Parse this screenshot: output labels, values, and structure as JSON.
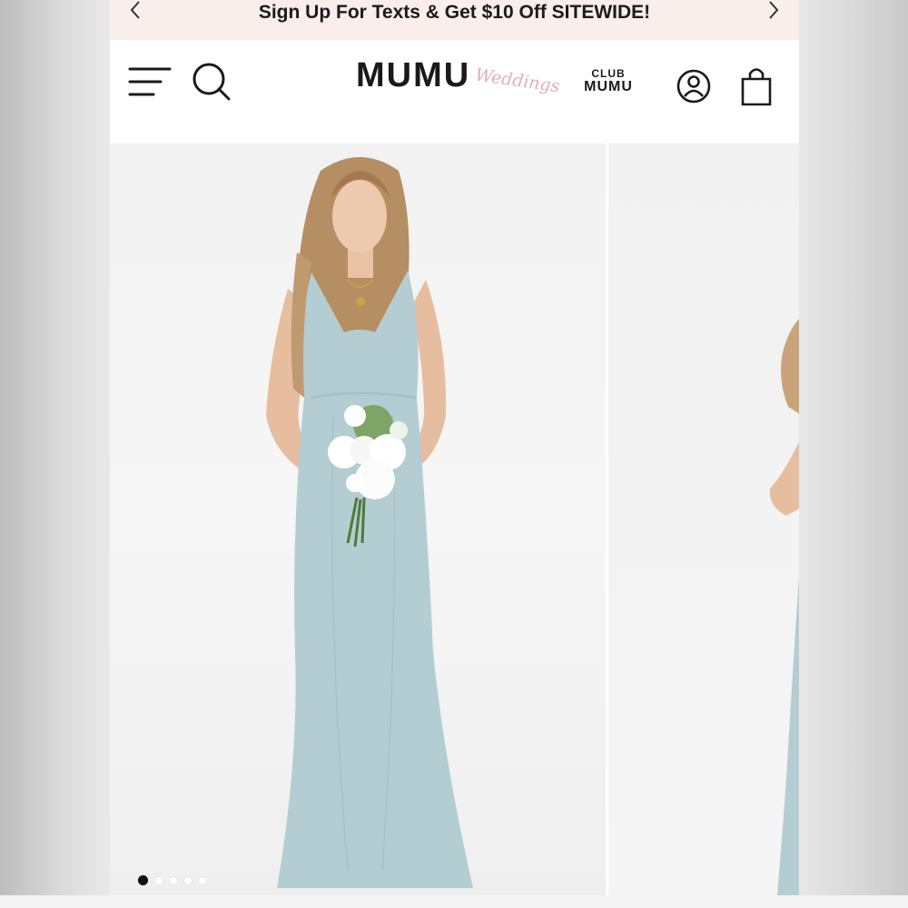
{
  "promo": {
    "text": "Sign Up For Texts & Get $10 Off SITEWIDE!"
  },
  "header": {
    "logo_text": "MUMU",
    "logo_script": "Weddings",
    "club_small": "CLUB",
    "club_big": "MUMU",
    "icons": [
      "menu-icon",
      "search-icon",
      "account-icon",
      "shopping-bag-icon"
    ]
  },
  "gallery": {
    "dots_total": 5,
    "active_dot": 1
  },
  "colors": {
    "promo_bg": "#f9eeea",
    "dress": "#b4cdd3",
    "script_pink": "#e4aeb4"
  }
}
